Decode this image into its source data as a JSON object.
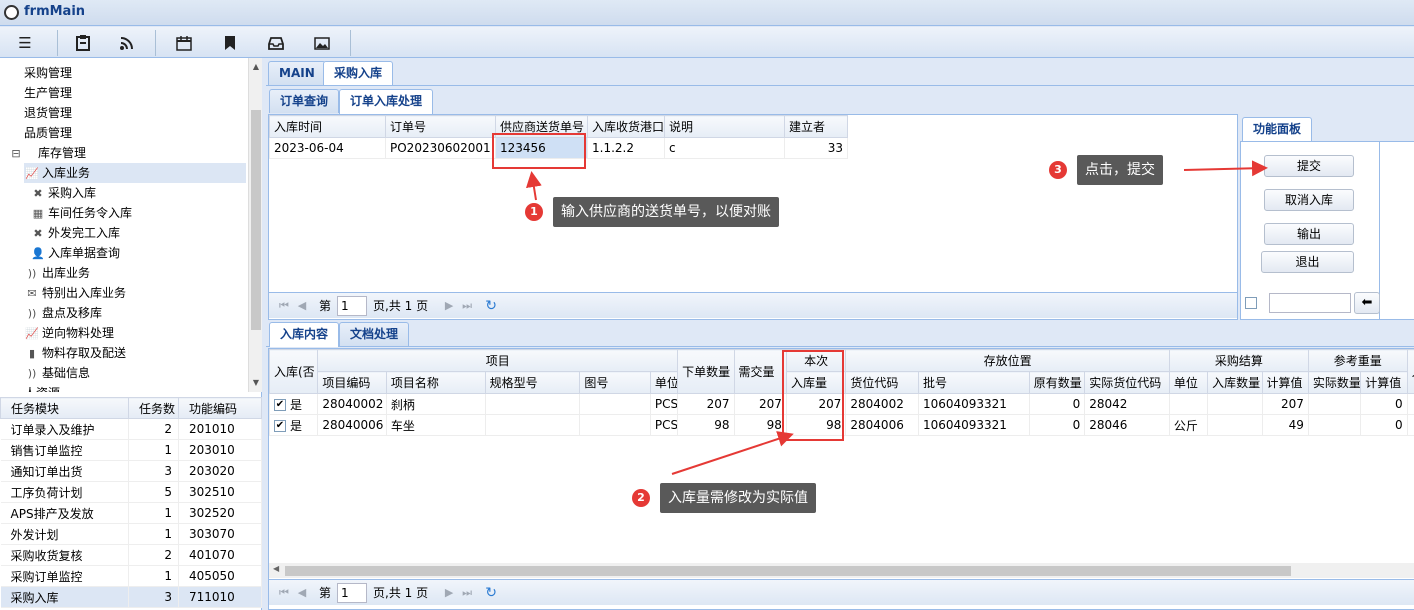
{
  "window": {
    "title": "frmMain"
  },
  "toolbar": {
    "icons": [
      "menu-icon",
      "clipboard-icon",
      "rss-icon",
      "calendar-icon",
      "bookmark-icon",
      "inbox-icon",
      "image-icon"
    ]
  },
  "tree": {
    "items": [
      {
        "label": "采购管理",
        "indent": 0,
        "icon": ""
      },
      {
        "label": "生产管理",
        "indent": 0,
        "icon": ""
      },
      {
        "label": "退货管理",
        "indent": 0,
        "icon": ""
      },
      {
        "label": "品质管理",
        "indent": 0,
        "icon": ""
      },
      {
        "label": "库存管理",
        "indent": 0,
        "icon": "⊟"
      },
      {
        "label": "入库业务",
        "indent": 1,
        "icon": "📈"
      },
      {
        "label": "采购入库",
        "indent": 2,
        "icon": "✖"
      },
      {
        "label": "车间任务令入库",
        "indent": 2,
        "icon": "▦"
      },
      {
        "label": "外发完工入库",
        "indent": 2,
        "icon": "✖"
      },
      {
        "label": "入库单据查询",
        "indent": 2,
        "icon": "👤"
      },
      {
        "label": "出库业务",
        "indent": 1,
        "icon": "))"
      },
      {
        "label": "特别出入库业务",
        "indent": 1,
        "icon": "✉"
      },
      {
        "label": "盘点及移库",
        "indent": 1,
        "icon": "))"
      },
      {
        "label": "逆向物料处理",
        "indent": 1,
        "icon": "📈"
      },
      {
        "label": "物料存取及配送",
        "indent": 1,
        "icon": "▮"
      },
      {
        "label": "基础信息",
        "indent": 1,
        "icon": "))"
      },
      {
        "label": "人资源",
        "indent": 0,
        "icon": ""
      }
    ]
  },
  "tasks": {
    "headers": [
      "任务模块",
      "任务数",
      "功能编码"
    ],
    "rows": [
      [
        "订单录入及维护",
        "2",
        "201010"
      ],
      [
        "销售订单监控",
        "1",
        "203010"
      ],
      [
        "通知订单出货",
        "3",
        "203020"
      ],
      [
        "工序负荷计划",
        "5",
        "302510"
      ],
      [
        "APS排产及发放",
        "1",
        "302520"
      ],
      [
        "外发计划",
        "1",
        "303070"
      ],
      [
        "采购收货复核",
        "2",
        "401070"
      ],
      [
        "采购订单监控",
        "1",
        "405050"
      ],
      [
        "采购入库",
        "3",
        "711010"
      ]
    ]
  },
  "main_tabs": [
    "MAIN",
    "采购入库"
  ],
  "sub_tabs": [
    "订单查询",
    "订单入库处理"
  ],
  "order_grid": {
    "headers": [
      "入库时间",
      "订单号",
      "供应商送货单号",
      "入库收货港口",
      "说明",
      "建立者"
    ],
    "row": [
      "2023-06-04",
      "PO20230602001",
      "123456",
      "1.1.2.2",
      "c",
      "33"
    ]
  },
  "pager1": {
    "first": "⏮",
    "prev": "◀",
    "label_pre": "第",
    "page": "1",
    "label_post": "页,共 1 页",
    "next": "▶",
    "last": "⏭",
    "refresh": "↻"
  },
  "func_panel": {
    "title": "功能面板",
    "buttons": [
      "提交",
      "取消入库",
      "输出",
      "退出"
    ],
    "enter": "⬅"
  },
  "bottom_tabs": [
    "入库内容",
    "文档处理"
  ],
  "detail": {
    "group_headers": [
      "项目",
      "本次",
      "存放位置",
      "采购结算",
      "参考重量"
    ],
    "headers_a": [
      "入库(否",
      "下单数量",
      "需交量"
    ],
    "headers_b": [
      "项目编码",
      "项目名称",
      "规格型号",
      "图号",
      "单位",
      "入库量",
      "货位代码",
      "批号",
      "原有数量",
      "实际货位代码",
      "单位",
      "入库数量",
      "计算值",
      "实际数量",
      "计算值",
      "入"
    ],
    "rows": [
      {
        "flag": "是",
        "code": "28040002",
        "name": "刹柄",
        "spec": "",
        "drawing": "",
        "unit": "PCS",
        "order_qty": "207",
        "due_qty": "207",
        "in_qty": "207",
        "loc": "2804002",
        "batch": "10604093321",
        "orig_qty": "0",
        "real_loc": "28042",
        "s_unit": "",
        "s_qty": "",
        "calc": "207",
        "w_real": "",
        "w_calc": "0"
      },
      {
        "flag": "是",
        "code": "28040006",
        "name": "车坐",
        "spec": "",
        "drawing": "",
        "unit": "PCS",
        "order_qty": "98",
        "due_qty": "98",
        "in_qty": "98",
        "loc": "2804006",
        "batch": "10604093321",
        "orig_qty": "0",
        "real_loc": "28046",
        "s_unit": "公斤",
        "s_qty": "",
        "calc": "49",
        "w_real": "",
        "w_calc": "0"
      }
    ]
  },
  "pager2": {
    "first": "⏮",
    "prev": "◀",
    "label_pre": "第",
    "page": "1",
    "label_post": "页,共 1 页",
    "next": "▶",
    "last": "⏭",
    "refresh": "↻"
  },
  "callouts": {
    "c1": {
      "num": "1",
      "text": "输入供应商的送货单号，以便对账"
    },
    "c2": {
      "num": "2",
      "text": "入库量需修改为实际值"
    },
    "c3": {
      "num": "3",
      "text": "点击，提交"
    }
  },
  "colors": {
    "accent": "#15428b",
    "border": "#99bbe8",
    "annotation": "#e53935"
  }
}
